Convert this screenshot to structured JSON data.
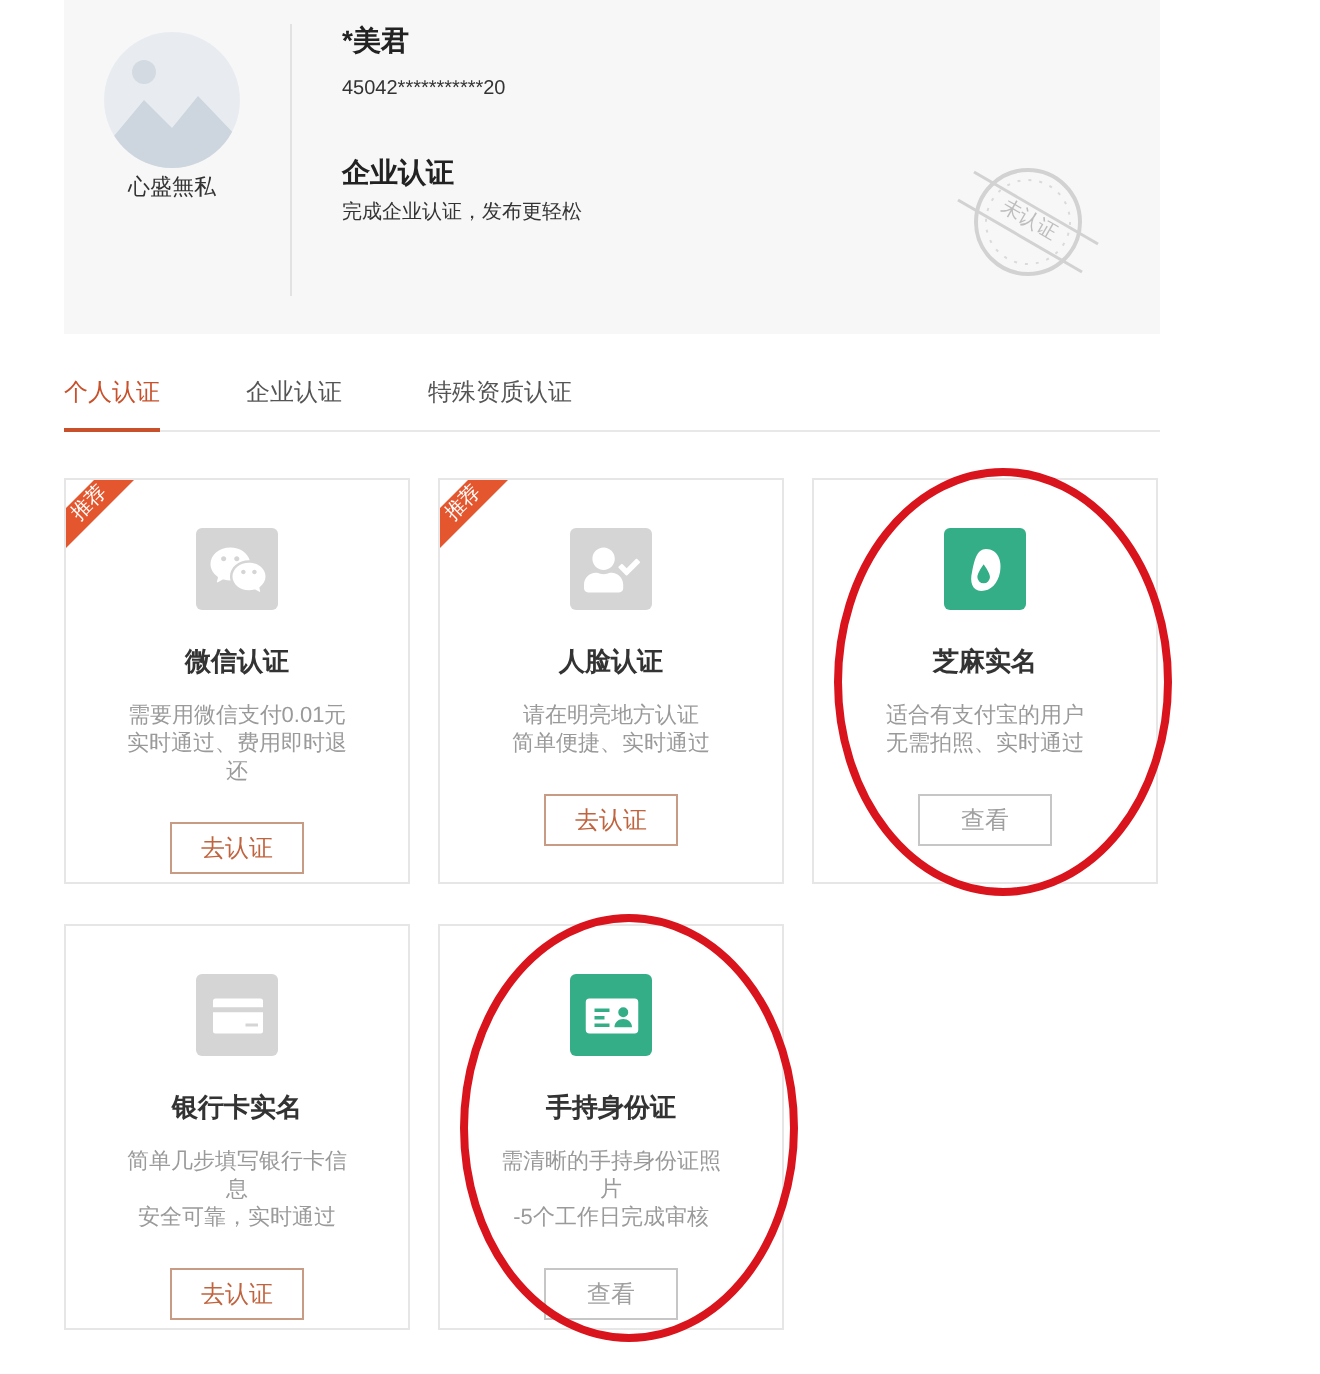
{
  "profile": {
    "avatar_caption": "心盛無私",
    "name": "*美君",
    "id_number": "45042***********20",
    "section_title": "企业认证",
    "section_subtitle": "完成企业认证，发布更轻松",
    "stamp": "未认证"
  },
  "tabs": [
    {
      "label": "个人认证",
      "selected": true
    },
    {
      "label": "企业认证",
      "selected": false
    },
    {
      "label": "特殊资质认证",
      "selected": false
    }
  ],
  "cards": [
    {
      "kind": "wechat",
      "badge": "推荐",
      "title": "微信认证",
      "description": [
        "需要用微信支付0.01元",
        "实时通过、费用即时退还"
      ],
      "button": "去认证",
      "verified": false,
      "circled": false
    },
    {
      "kind": "face",
      "badge": "推荐",
      "title": "人脸认证",
      "description": [
        "请在明亮地方认证",
        "简单便捷、实时通过"
      ],
      "button": "去认证",
      "verified": false,
      "circled": false
    },
    {
      "kind": "sesame",
      "title": "芝麻实名",
      "description": [
        "适合有支付宝的用户",
        "无需拍照、实时通过"
      ],
      "button": "查看",
      "verified": true,
      "circled": true
    },
    {
      "kind": "bankcard",
      "title": "银行卡实名",
      "description": [
        "简单几步填写银行卡信息",
        "安全可靠，实时通过"
      ],
      "button": "去认证",
      "verified": false,
      "circled": false
    },
    {
      "kind": "idcard",
      "title": "手持身份证",
      "description": [
        "需清晰的手持身份证照片",
        "-5个工作日完成审核"
      ],
      "button": "查看",
      "verified": true,
      "circled": true
    }
  ]
}
